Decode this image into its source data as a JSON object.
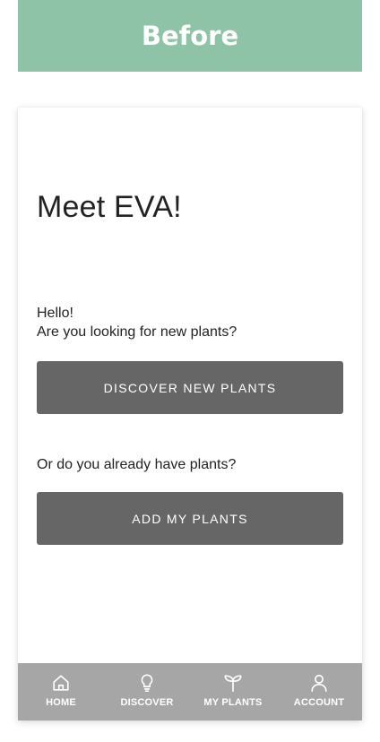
{
  "banner": {
    "label": "Before",
    "color": "#8fc3a8"
  },
  "screen": {
    "title": "Meet EVA!",
    "greeting_line1": "Hello!",
    "greeting_line2": "Are you looking for new plants?",
    "discover_button_label": "DISCOVER NEW PLANTS",
    "question": "Or do you already have plants?",
    "add_button_label": "ADD MY PLANTS",
    "button_color": "#666666"
  },
  "nav": {
    "background": "#a6a6a6",
    "items": [
      {
        "label": "HOME",
        "icon": "home-icon"
      },
      {
        "label": "DISCOVER",
        "icon": "lightbulb-icon"
      },
      {
        "label": "MY PLANTS",
        "icon": "sprout-icon"
      },
      {
        "label": "ACCOUNT",
        "icon": "user-icon"
      }
    ]
  }
}
